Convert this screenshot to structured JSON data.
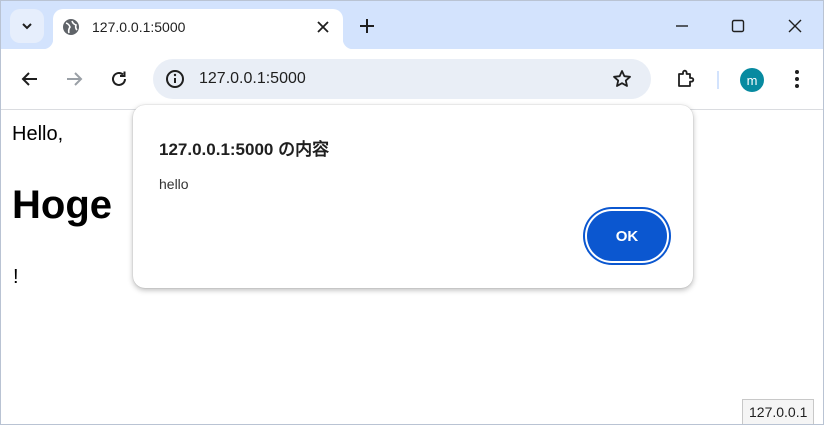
{
  "tab": {
    "title": "127.0.0.1:5000",
    "favicon": "globe-icon"
  },
  "omnibox": {
    "url": "127.0.0.1:5000"
  },
  "profile": {
    "initial": "m",
    "color": "#078aa0"
  },
  "page": {
    "greeting": "Hello,",
    "name": "Hoge",
    "exclamation": "!"
  },
  "dialog": {
    "title": "127.0.0.1:5000 の内容",
    "message": "hello",
    "ok_label": "OK"
  },
  "status_bar": {
    "url": "127.0.0.1"
  },
  "colors": {
    "tabstrip": "#d3e3fd",
    "omnibox": "#e9eef6",
    "accent": "#0b57d0"
  }
}
